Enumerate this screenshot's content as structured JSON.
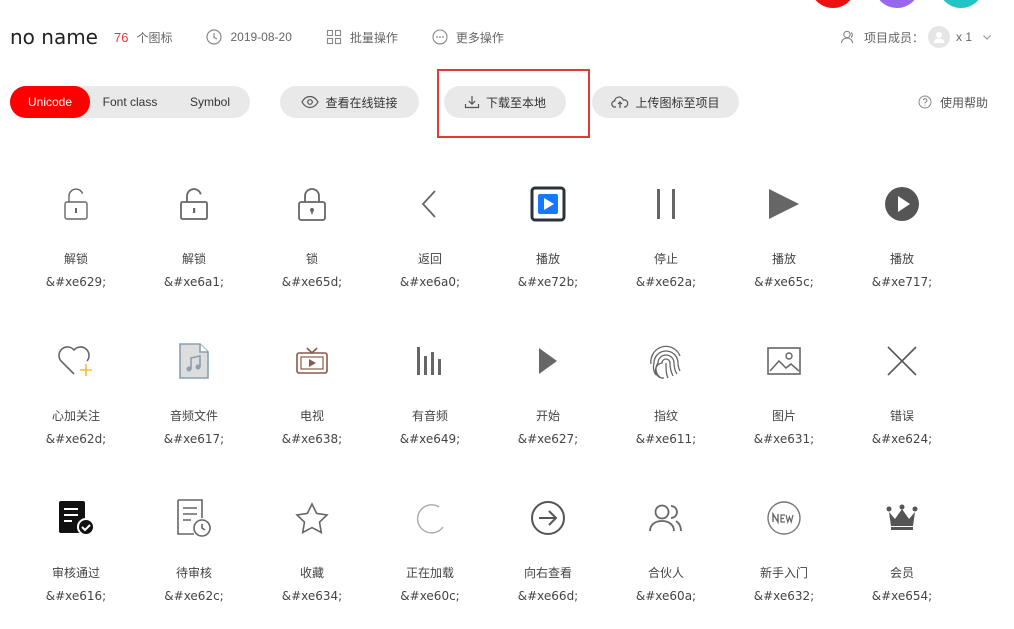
{
  "colors": {
    "accent": "#ff0000",
    "count": "#e4393c",
    "circle1": "#ee1111",
    "circle2": "#9966ee",
    "circle3": "#22c4c4"
  },
  "header": {
    "project_name": "no name",
    "icon_count": "76",
    "icon_count_label": "个图标",
    "date": "2019-08-20",
    "batch_label": "批量操作",
    "more_label": "更多操作",
    "members_label": "项目成员：",
    "members_count": "x 1"
  },
  "toolbar": {
    "tabs": [
      {
        "label": "Unicode",
        "active": true
      },
      {
        "label": "Font class",
        "active": false
      },
      {
        "label": "Symbol",
        "active": false
      }
    ],
    "view_link_label": "查看在线链接",
    "download_label": "下载至本地",
    "upload_label": "上传图标至项目",
    "help_label": "使用帮助"
  },
  "icons": [
    {
      "name": "解锁",
      "code": "&#xe629;",
      "glyph": "unlock-thin"
    },
    {
      "name": "解锁",
      "code": "&#xe6a1;",
      "glyph": "unlock"
    },
    {
      "name": "锁",
      "code": "&#xe65d;",
      "glyph": "lock"
    },
    {
      "name": "返回",
      "code": "&#xe6a0;",
      "glyph": "chevron-left"
    },
    {
      "name": "播放",
      "code": "&#xe72b;",
      "glyph": "play-box"
    },
    {
      "name": "停止",
      "code": "&#xe62a;",
      "glyph": "pause"
    },
    {
      "name": "播放",
      "code": "&#xe65c;",
      "glyph": "play-triangle"
    },
    {
      "name": "播放",
      "code": "&#xe717;",
      "glyph": "play-circle"
    },
    {
      "name": "心加关注",
      "code": "&#xe62d;",
      "glyph": "heart-plus"
    },
    {
      "name": "音频文件",
      "code": "&#xe617;",
      "glyph": "audio-file"
    },
    {
      "name": "电视",
      "code": "&#xe638;",
      "glyph": "tv"
    },
    {
      "name": "有音频",
      "code": "&#xe649;",
      "glyph": "audio-bars"
    },
    {
      "name": "开始",
      "code": "&#xe627;",
      "glyph": "play-small"
    },
    {
      "name": "指纹",
      "code": "&#xe611;",
      "glyph": "fingerprint"
    },
    {
      "name": "图片",
      "code": "&#xe631;",
      "glyph": "image"
    },
    {
      "name": "错误",
      "code": "&#xe624;",
      "glyph": "close"
    },
    {
      "name": "审核通过",
      "code": "&#xe616;",
      "glyph": "doc-check"
    },
    {
      "name": "待审核",
      "code": "&#xe62c;",
      "glyph": "doc-clock"
    },
    {
      "name": "收藏",
      "code": "&#xe634;",
      "glyph": "star"
    },
    {
      "name": "正在加载",
      "code": "&#xe60c;",
      "glyph": "loading"
    },
    {
      "name": "向右查看",
      "code": "&#xe66d;",
      "glyph": "arrow-right-circle"
    },
    {
      "name": "合伙人",
      "code": "&#xe60a;",
      "glyph": "partners"
    },
    {
      "name": "新手入门",
      "code": "&#xe632;",
      "glyph": "new-badge"
    },
    {
      "name": "会员",
      "code": "&#xe654;",
      "glyph": "crown"
    }
  ]
}
